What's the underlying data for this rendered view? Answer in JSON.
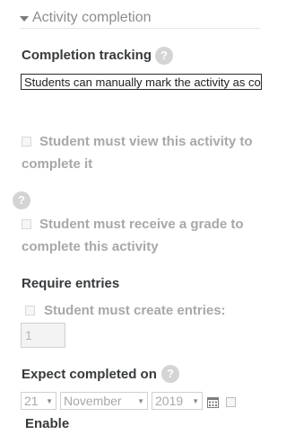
{
  "section": {
    "title": "Activity completion"
  },
  "completion_tracking": {
    "label": "Completion tracking",
    "help": "?",
    "selected": "Students can manually mark the activity as completed"
  },
  "view_condition": {
    "label_line1": "Student must view this activity to",
    "label_line2": "complete it"
  },
  "grade_condition": {
    "help": "?",
    "label_line1": "Student must receive a grade to",
    "label_line2": "complete this activity"
  },
  "require_entries": {
    "title": "Require entries",
    "checkbox_label": "Student must create entries:",
    "value": "1"
  },
  "expect_completed": {
    "label": "Expect completed on",
    "help": "?",
    "day": "21",
    "month": "November",
    "year": "2019",
    "enable_label": "Enable",
    "calendar_icon": "calendar-icon"
  }
}
